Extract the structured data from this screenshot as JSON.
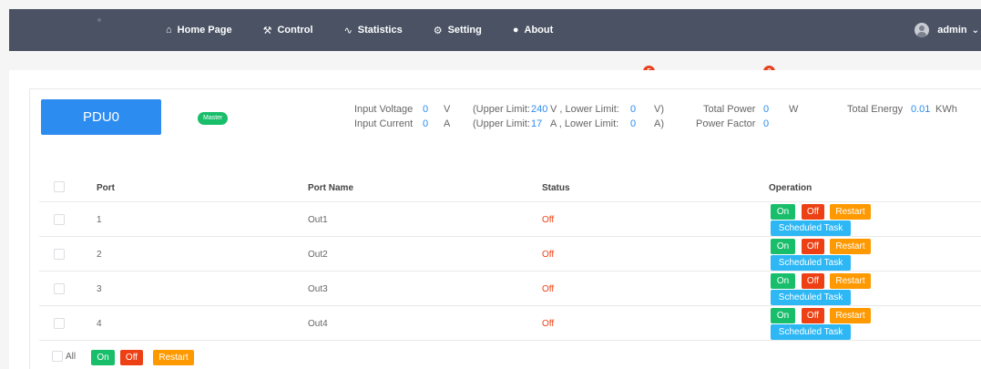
{
  "nav": {
    "items": [
      {
        "label": "Home Page",
        "icon": "home-icon",
        "glyph": "⌂"
      },
      {
        "label": "Control",
        "icon": "tools-icon",
        "glyph": "⚒"
      },
      {
        "label": "Statistics",
        "icon": "pulse-icon",
        "glyph": "∿"
      },
      {
        "label": "Setting",
        "icon": "gear-icon",
        "glyph": "⚙"
      },
      {
        "label": "About",
        "icon": "info-circle-icon",
        "glyph": "●"
      }
    ],
    "user": "admin",
    "chevron": "⌄"
  },
  "badges": {
    "voltage": "5",
    "power": "2"
  },
  "pdu": {
    "name": "PDU0",
    "role": "Master",
    "input_voltage_label": "Input Voltage",
    "input_voltage": "0",
    "voltage_unit": "V",
    "voltage_limits_prefix": "(Upper Limit:",
    "voltage_upper": "240",
    "voltage_mid": "V , Lower Limit:",
    "voltage_lower": "0",
    "voltage_suffix": "V)",
    "input_current_label": "Input Current",
    "input_current": "0",
    "current_unit": "A",
    "current_limits_prefix": "(Upper Limit:",
    "current_upper": "17",
    "current_mid": "A , Lower Limit:",
    "current_lower": "0",
    "current_suffix": "A)",
    "total_power_label": "Total Power",
    "total_power": "0",
    "power_unit": "W",
    "power_factor_label": "Power Factor",
    "power_factor": "0",
    "total_energy_label": "Total Energy",
    "total_energy": "0.01",
    "energy_unit": "KWh"
  },
  "table": {
    "headers": {
      "port": "Port",
      "name": "Port Name",
      "status": "Status",
      "operation": "Operation"
    },
    "rows": [
      {
        "port": "1",
        "name": "Out1",
        "status": "Off"
      },
      {
        "port": "2",
        "name": "Out2",
        "status": "Off"
      },
      {
        "port": "3",
        "name": "Out3",
        "status": "Off"
      },
      {
        "port": "4",
        "name": "Out4",
        "status": "Off"
      }
    ],
    "buttons": {
      "on": "On",
      "off": "Off",
      "restart": "Restart",
      "scheduled": "Scheduled Task"
    }
  },
  "footer": {
    "all_label": "All",
    "on": "On",
    "off": "Off",
    "restart": "Restart"
  },
  "colors": {
    "nav_bg": "#4a5264",
    "primary": "#2d8cf0",
    "success": "#19be6b",
    "danger": "#ed4014",
    "warning": "#ff9900",
    "info": "#2db7f5"
  }
}
